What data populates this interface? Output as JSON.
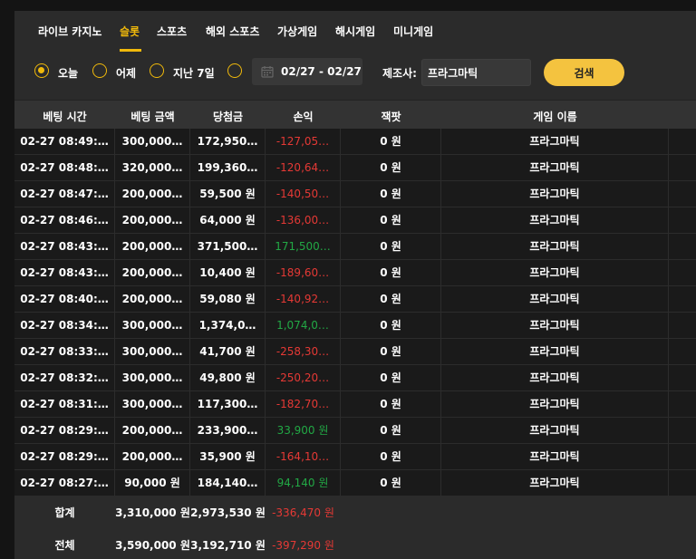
{
  "tabs": [
    {
      "label": "라이브 카지노",
      "active": false
    },
    {
      "label": "슬롯",
      "active": true
    },
    {
      "label": "스포츠",
      "active": false
    },
    {
      "label": "해외 스포츠",
      "active": false
    },
    {
      "label": "가상게임",
      "active": false
    },
    {
      "label": "해시게임",
      "active": false
    },
    {
      "label": "미니게임",
      "active": false
    }
  ],
  "filter": {
    "options": [
      {
        "label": "오늘",
        "checked": true
      },
      {
        "label": "어제",
        "checked": false
      },
      {
        "label": "지난 7일",
        "checked": false
      },
      {
        "label": "",
        "checked": false
      }
    ],
    "date_range": "02/27 - 02/27",
    "maker_label": "제조사:",
    "maker_value": "프라그마틱",
    "search_label": "검색"
  },
  "table": {
    "headers": [
      "베팅 시간",
      "베팅 금액",
      "당첨금",
      "손익",
      "잭팟",
      "게임 이름"
    ],
    "rows": [
      {
        "time": "02-27 08:49:…",
        "bet": "300,000…",
        "win": "172,950…",
        "pl": "-127,05…",
        "pl_sign": "neg",
        "jackpot": "0 원",
        "game": "프라그마틱"
      },
      {
        "time": "02-27 08:48:…",
        "bet": "320,000…",
        "win": "199,360…",
        "pl": "-120,64…",
        "pl_sign": "neg",
        "jackpot": "0 원",
        "game": "프라그마틱"
      },
      {
        "time": "02-27 08:47:…",
        "bet": "200,000…",
        "win": "59,500 원",
        "pl": "-140,50…",
        "pl_sign": "neg",
        "jackpot": "0 원",
        "game": "프라그마틱"
      },
      {
        "time": "02-27 08:46:…",
        "bet": "200,000…",
        "win": "64,000 원",
        "pl": "-136,00…",
        "pl_sign": "neg",
        "jackpot": "0 원",
        "game": "프라그마틱"
      },
      {
        "time": "02-27 08:43:…",
        "bet": "200,000…",
        "win": "371,500…",
        "pl": "171,500…",
        "pl_sign": "pos",
        "jackpot": "0 원",
        "game": "프라그마틱"
      },
      {
        "time": "02-27 08:43:…",
        "bet": "200,000…",
        "win": "10,400 원",
        "pl": "-189,60…",
        "pl_sign": "neg",
        "jackpot": "0 원",
        "game": "프라그마틱"
      },
      {
        "time": "02-27 08:40:…",
        "bet": "200,000…",
        "win": "59,080 원",
        "pl": "-140,92…",
        "pl_sign": "neg",
        "jackpot": "0 원",
        "game": "프라그마틱"
      },
      {
        "time": "02-27 08:34:…",
        "bet": "300,000…",
        "win": "1,374,0…",
        "pl": "1,074,0…",
        "pl_sign": "pos",
        "jackpot": "0 원",
        "game": "프라그마틱"
      },
      {
        "time": "02-27 08:33:…",
        "bet": "300,000…",
        "win": "41,700 원",
        "pl": "-258,30…",
        "pl_sign": "neg",
        "jackpot": "0 원",
        "game": "프라그마틱"
      },
      {
        "time": "02-27 08:32:…",
        "bet": "300,000…",
        "win": "49,800 원",
        "pl": "-250,20…",
        "pl_sign": "neg",
        "jackpot": "0 원",
        "game": "프라그마틱"
      },
      {
        "time": "02-27 08:31:…",
        "bet": "300,000…",
        "win": "117,300…",
        "pl": "-182,70…",
        "pl_sign": "neg",
        "jackpot": "0 원",
        "game": "프라그마틱"
      },
      {
        "time": "02-27 08:29:…",
        "bet": "200,000…",
        "win": "233,900…",
        "pl": "33,900 원",
        "pl_sign": "pos",
        "jackpot": "0 원",
        "game": "프라그마틱"
      },
      {
        "time": "02-27 08:29:…",
        "bet": "200,000…",
        "win": "35,900 원",
        "pl": "-164,10…",
        "pl_sign": "neg",
        "jackpot": "0 원",
        "game": "프라그마틱"
      },
      {
        "time": "02-27 08:27:…",
        "bet": "90,000 원",
        "win": "184,140…",
        "pl": "94,140 원",
        "pl_sign": "pos",
        "jackpot": "0 원",
        "game": "프라그마틱"
      }
    ]
  },
  "totals": [
    {
      "label": "합계",
      "bet": "3,310,000 원",
      "win": "2,973,530 원",
      "pl": "-336,470 원"
    },
    {
      "label": "전체",
      "bet": "3,590,000 원",
      "win": "3,192,710 원",
      "pl": "-397,290 원"
    }
  ],
  "colors": {
    "accent": "#f0b90b",
    "negative": "#e53935",
    "positive": "#22a845"
  }
}
